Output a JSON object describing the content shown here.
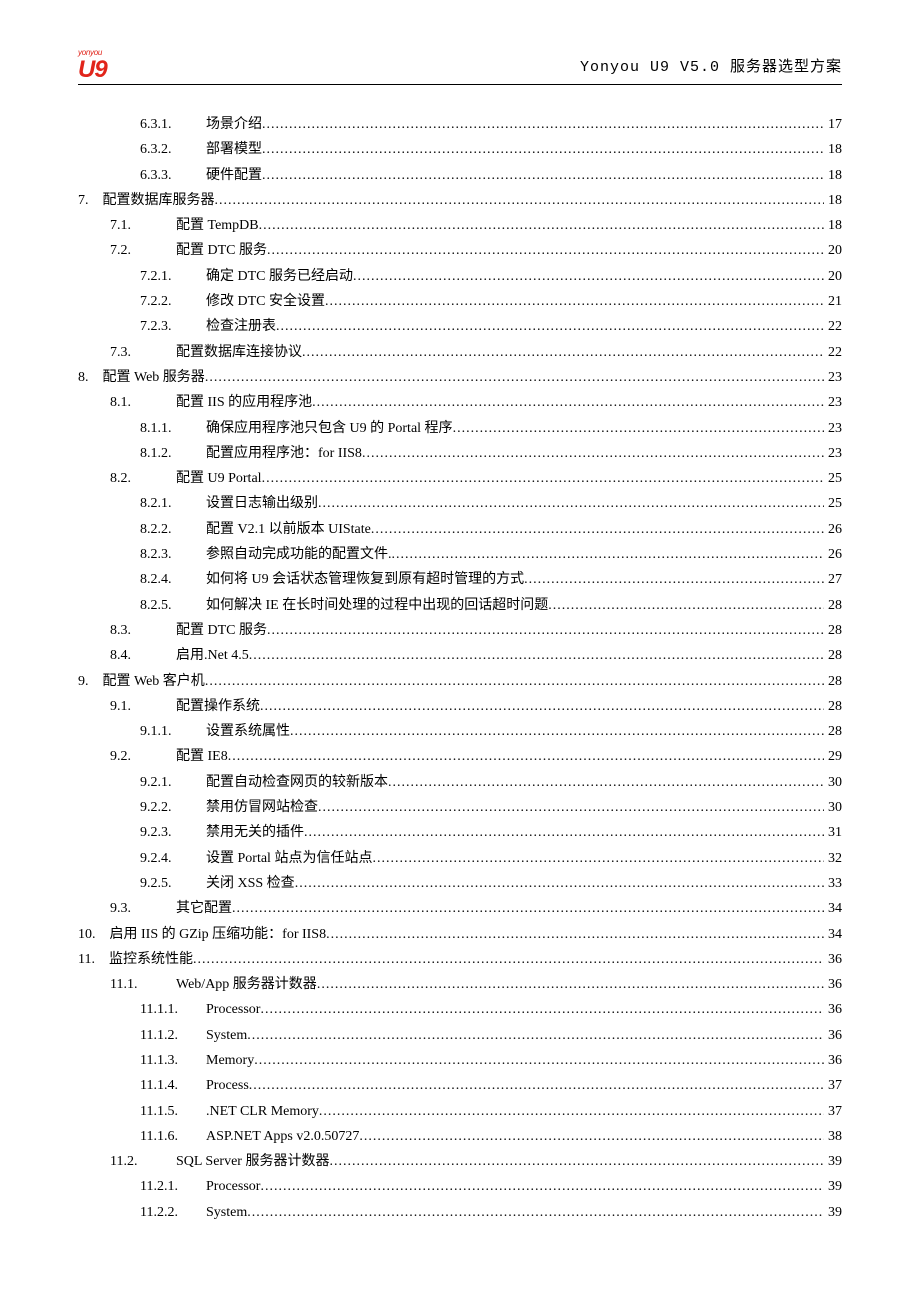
{
  "header": {
    "logo_small": "yonyou",
    "logo_big": "U9",
    "doc_title": "Yonyou U9 V5.0 服务器选型方案"
  },
  "toc": [
    {
      "level": 3,
      "num": "6.3.1.",
      "title": "场景介绍",
      "page": "17"
    },
    {
      "level": 3,
      "num": "6.3.2.",
      "title": "部署模型",
      "page": "18"
    },
    {
      "level": 3,
      "num": "6.3.3.",
      "title": "硬件配置",
      "page": "18"
    },
    {
      "level": 1,
      "num": "7.",
      "title": "配置数据库服务器",
      "page": "18"
    },
    {
      "level": 2,
      "num": "7.1.",
      "title": "配置 TempDB",
      "page": "18"
    },
    {
      "level": 2,
      "num": "7.2.",
      "title": "配置 DTC 服务",
      "page": "20"
    },
    {
      "level": 3,
      "num": "7.2.1.",
      "title": "确定 DTC 服务已经启动",
      "page": "20"
    },
    {
      "level": 3,
      "num": "7.2.2.",
      "title": "修改 DTC 安全设置",
      "page": "21"
    },
    {
      "level": 3,
      "num": "7.2.3.",
      "title": "检查注册表",
      "page": "22"
    },
    {
      "level": 2,
      "num": "7.3.",
      "title": "配置数据库连接协议",
      "page": "22"
    },
    {
      "level": 1,
      "num": "8.",
      "title": "配置 Web 服务器",
      "page": "23"
    },
    {
      "level": 2,
      "num": "8.1.",
      "title": "配置 IIS 的应用程序池",
      "page": "23"
    },
    {
      "level": 3,
      "num": "8.1.1.",
      "title": "确保应用程序池只包含 U9 的 Portal 程序",
      "page": "23"
    },
    {
      "level": 3,
      "num": "8.1.2.",
      "title": "配置应用程序池：for IIS8",
      "page": "23"
    },
    {
      "level": 2,
      "num": "8.2.",
      "title": "配置 U9 Portal",
      "page": "25"
    },
    {
      "level": 3,
      "num": "8.2.1.",
      "title": "设置日志输出级别",
      "page": "25"
    },
    {
      "level": 3,
      "num": "8.2.2.",
      "title": "配置 V2.1  以前版本 UIState",
      "page": "26"
    },
    {
      "level": 3,
      "num": "8.2.3.",
      "title": "参照自动完成功能的配置文件.",
      "page": "26"
    },
    {
      "level": 3,
      "num": "8.2.4.",
      "title": "如何将 U9 会话状态管理恢复到原有超时管理的方式",
      "page": "27"
    },
    {
      "level": 3,
      "num": "8.2.5.",
      "title": "如何解决 IE 在长时间处理的过程中出现的回话超时问题",
      "page": "28"
    },
    {
      "level": 2,
      "num": "8.3.",
      "title": "配置 DTC 服务",
      "page": "28"
    },
    {
      "level": 2,
      "num": "8.4.",
      "title": "启用.Net 4.5",
      "page": "28"
    },
    {
      "level": 1,
      "num": "9.",
      "title": "配置 Web 客户机",
      "page": "28"
    },
    {
      "level": 2,
      "num": "9.1.",
      "title": "配置操作系统",
      "page": "28"
    },
    {
      "level": 3,
      "num": "9.1.1.",
      "title": "设置系统属性",
      "page": "28"
    },
    {
      "level": 2,
      "num": "9.2.",
      "title": "配置 IE8",
      "page": "29"
    },
    {
      "level": 3,
      "num": "9.2.1.",
      "title": "配置自动检查网页的较新版本",
      "page": "30"
    },
    {
      "level": 3,
      "num": "9.2.2.",
      "title": "禁用仿冒网站检查",
      "page": "30"
    },
    {
      "level": 3,
      "num": "9.2.3.",
      "title": "禁用无关的插件",
      "page": "31"
    },
    {
      "level": 3,
      "num": "9.2.4.",
      "title": "设置 Portal 站点为信任站点",
      "page": "32"
    },
    {
      "level": 3,
      "num": "9.2.5.",
      "title": "关闭 XSS 检查",
      "page": "33"
    },
    {
      "level": 2,
      "num": "9.3.",
      "title": "其它配置",
      "page": "34"
    },
    {
      "level": 1,
      "num": "10.",
      "title": "启用 IIS 的 GZip 压缩功能：for IIS8",
      "page": "34"
    },
    {
      "level": 1,
      "num": "11.",
      "title": "监控系统性能",
      "page": "36"
    },
    {
      "level": 2,
      "num": "11.1.",
      "title": "Web/App 服务器计数器",
      "page": "36"
    },
    {
      "level": 3,
      "num": "11.1.1.",
      "title": "Processor",
      "page": "36"
    },
    {
      "level": 3,
      "num": "11.1.2.",
      "title": "System",
      "page": "36"
    },
    {
      "level": 3,
      "num": "11.1.3.",
      "title": "Memory",
      "page": "36"
    },
    {
      "level": 3,
      "num": "11.1.4.",
      "title": "Process",
      "page": "37"
    },
    {
      "level": 3,
      "num": "11.1.5.",
      "title": ".NET CLR Memory",
      "page": "37"
    },
    {
      "level": 3,
      "num": "11.1.6.",
      "title": "ASP.NET Apps v2.0.50727",
      "page": "38"
    },
    {
      "level": 2,
      "num": "11.2.",
      "title": "SQL Server 服务器计数器",
      "page": "39"
    },
    {
      "level": 3,
      "num": "11.2.1.",
      "title": "Processor",
      "page": "39"
    },
    {
      "level": 3,
      "num": "11.2.2.",
      "title": "System",
      "page": "39"
    }
  ]
}
